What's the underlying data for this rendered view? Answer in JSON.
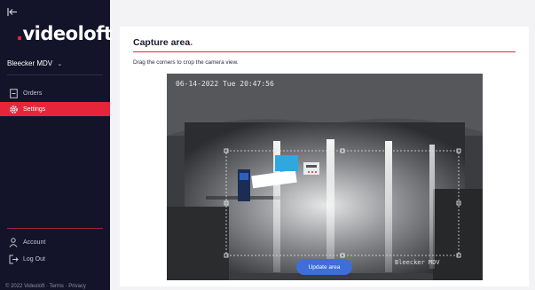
{
  "sidebar": {
    "logo_mark": ".",
    "logo_text": "videoloft",
    "location": "Bleecker MDV",
    "nav": [
      {
        "label": "Orders",
        "icon": "document-icon"
      },
      {
        "label": "Settings",
        "icon": "gear-icon",
        "active": true
      }
    ],
    "bottom": [
      {
        "label": "Account",
        "icon": "person-icon"
      },
      {
        "label": "Log Out",
        "icon": "logout-icon"
      }
    ],
    "footer": "© 2022 Videoloft · Terms · Privacy"
  },
  "main": {
    "title": "Capture area",
    "title_dot": ".",
    "instructions": "Drag the corners to crop the camera view.",
    "camera": {
      "timestamp": "06-14-2022 Tue 20:47:56",
      "camera_name": "Bleecker MDV"
    },
    "update_button": "Update area"
  },
  "colors": {
    "accent": "#e8243b",
    "sidebar_bg": "#13142a",
    "button": "#3e6ed8"
  }
}
